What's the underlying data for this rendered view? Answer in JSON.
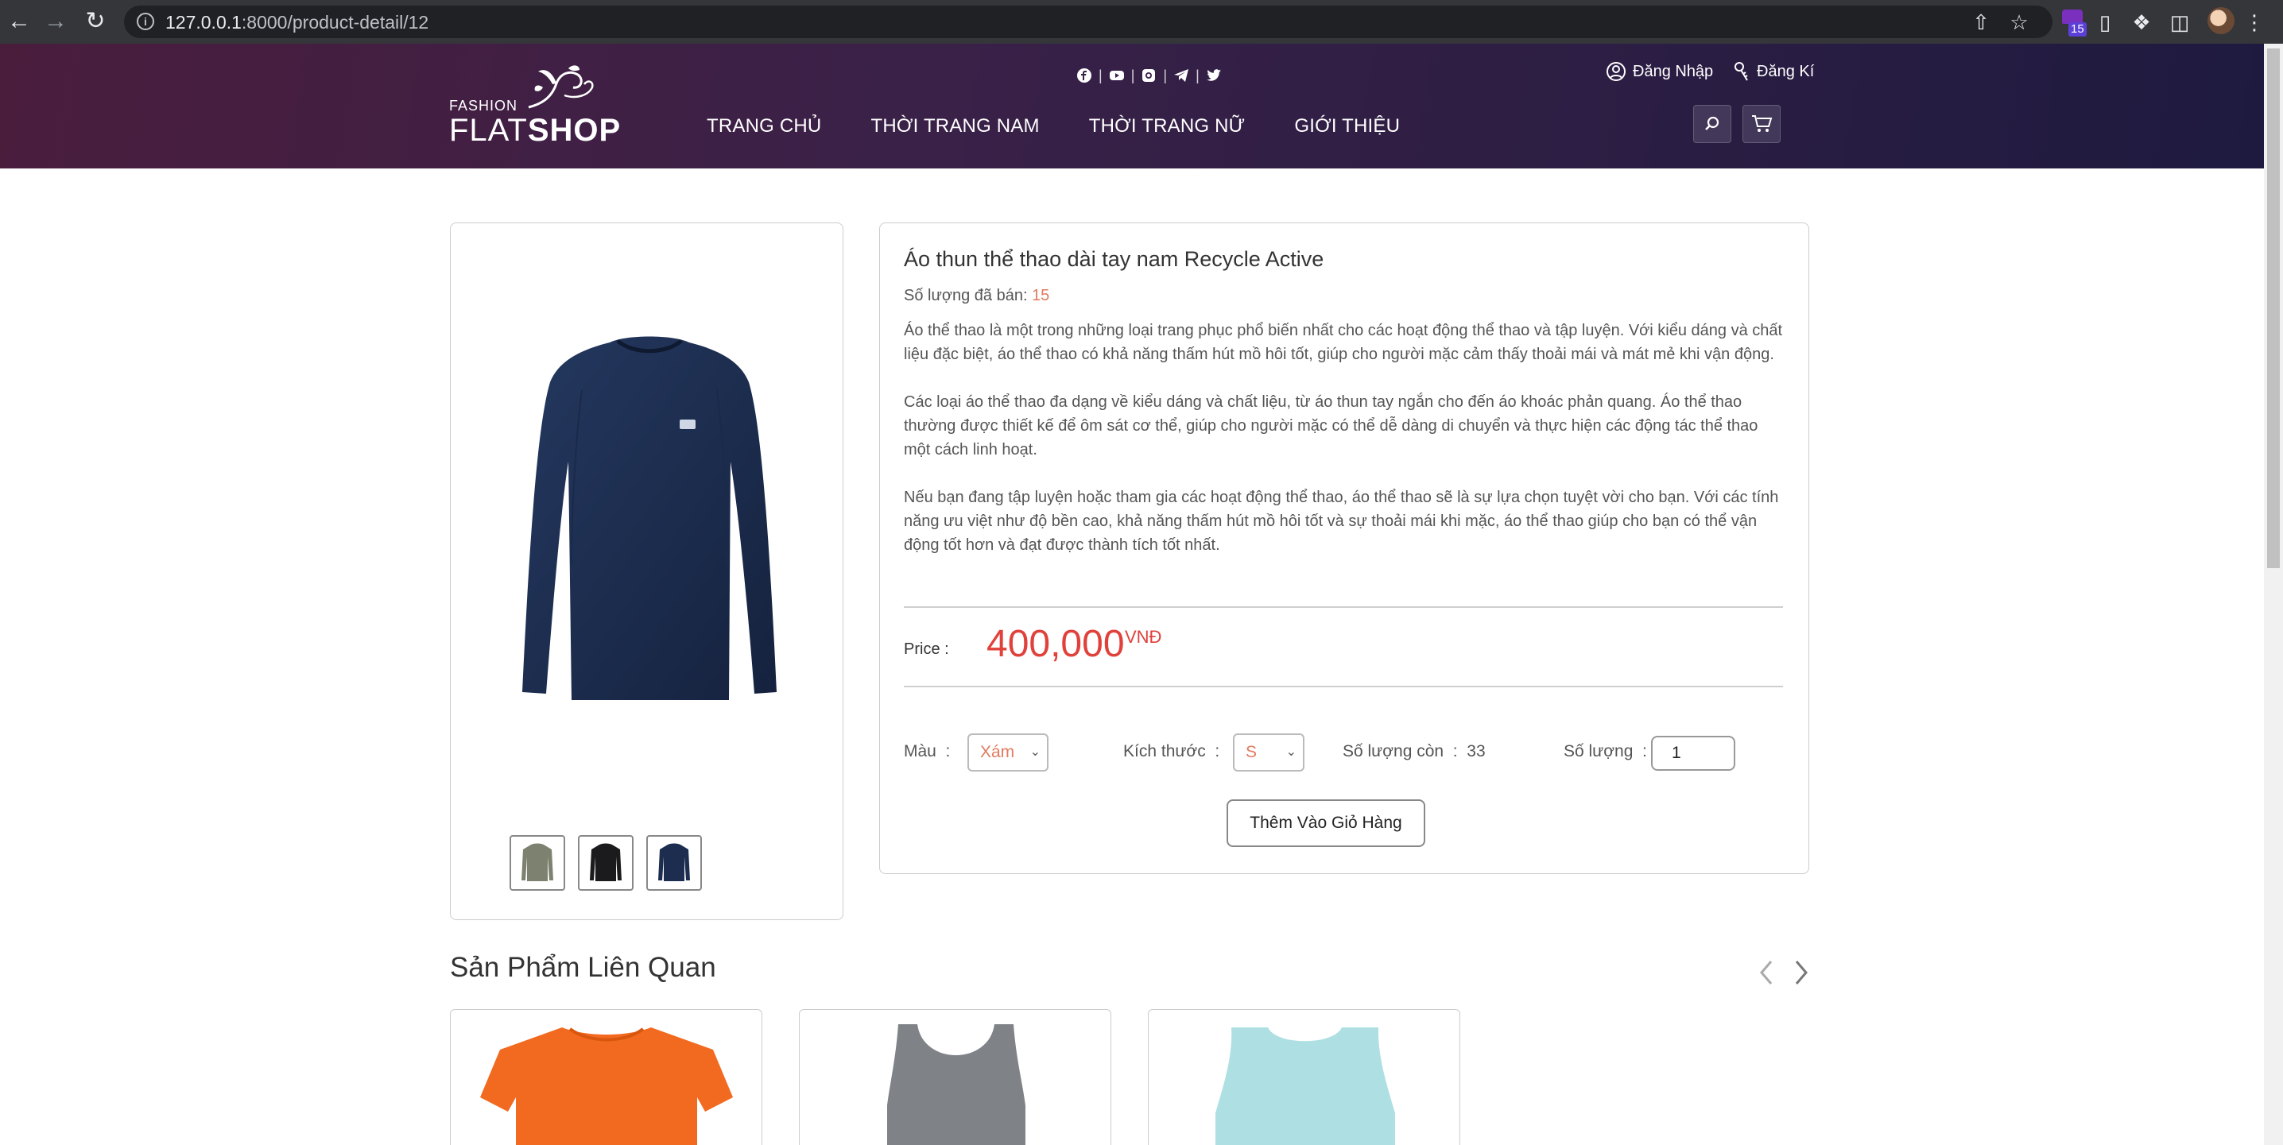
{
  "browser": {
    "url_host": "127.0.0.1",
    "url_rest": ":8000/product-detail/12",
    "extension_badge": "15"
  },
  "header": {
    "logo_small": "FASHION",
    "logo_flat": "FLAT",
    "logo_shop": "SHOP",
    "login": "Đăng Nhập",
    "register": "Đăng Kí",
    "nav": [
      "TRANG CHỦ",
      "THỜI TRANG NAM",
      "THỜI TRANG NỮ",
      "GIỚI THIỆU"
    ]
  },
  "product": {
    "title": "Áo thun thể thao dài tay nam Recycle Active",
    "sold_label": "Số lượng đã bán:",
    "sold_value": "15",
    "description": [
      "Áo thể thao là một trong những loại trang phục phổ biến nhất cho các hoạt động thể thao và tập luyện. Với kiểu dáng và chất liệu đặc biệt, áo thể thao có khả năng thấm hút mồ hôi tốt, giúp cho người mặc cảm thấy thoải mái và mát mẻ khi vận động.",
      "Các loại áo thể thao đa dạng về kiểu dáng và chất liệu, từ áo thun tay ngắn cho đến áo khoác phản quang. Áo thể thao thường được thiết kế để ôm sát cơ thể, giúp cho người mặc có thể dễ dàng di chuyển và thực hiện các động tác thể thao một cách linh hoạt.",
      "Nếu bạn đang tập luyện hoặc tham gia các hoạt động thể thao, áo thể thao sẽ là sự lựa chọn tuyệt vời cho bạn. Với các tính năng ưu việt như độ bền cao, khả năng thấm hút mồ hôi tốt và sự thoải mái khi mặc, áo thể thao giúp cho bạn có thể vận động tốt hơn và đạt được thành tích tốt nhất."
    ],
    "price_label": "Price :",
    "price": "400,000",
    "currency": "VNĐ",
    "color_label": "Màu",
    "color_value": "Xám",
    "size_label": "Kích thước",
    "size_value": "S",
    "stock_label": "Số lượng còn",
    "stock_value": "33",
    "qty_label": "Số lượng",
    "qty_value": "1",
    "add_to_cart": "Thêm Vào Giỏ Hàng",
    "colors": {
      "accent": "#e0413a",
      "muted_accent": "#e07b5f",
      "shirt_main": "#1c2d4f"
    }
  },
  "related": {
    "title": "Sản Phẩm Liên Quan"
  }
}
